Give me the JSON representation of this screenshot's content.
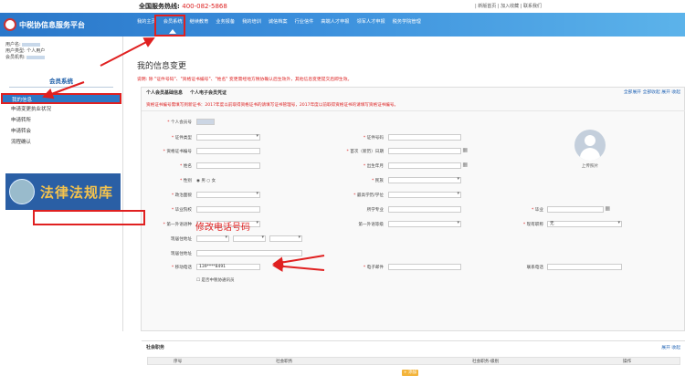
{
  "topbar": {
    "hotline_label": "全国服务热线:",
    "hotline_number": "400-082-5868",
    "links": "| 新版首页 | 加入收藏 | 联系我们"
  },
  "header": {
    "logo_text": "中税协信息服务平台"
  },
  "nav": {
    "items": [
      "我的主页",
      "会员系统",
      "继续教育",
      "业务报备",
      "我的培训",
      "诚信档案",
      "行业信件",
      "高端人才申报",
      "领军人才申报",
      "税务学院管理"
    ]
  },
  "sidebar": {
    "user_label": "用户名:",
    "type_label": "用户类型: 个人用户",
    "company_label": "会员机构:",
    "section_title": "会员系统",
    "menu": [
      "我的信息",
      "申请变更执业状况",
      "申请转所",
      "申请转会",
      "流程确认"
    ],
    "banner_text": "法律法规库"
  },
  "page": {
    "title": "我的信息变更",
    "notice": "说明: 除 \"证件号码\"、\"资格证书编号\"、\"姓名\" 变更需经地方税协确认后生效外，其他信息变更提交后即生效。",
    "tab1": "个人会员基础信息",
    "tab2": "个人电子会员凭证",
    "panel_links": "全部展开 全部收起 展开 收起",
    "red_line": "资格证书编号需填写到新证书：2017年度以前取得资格证书的请填写证书管理号，2017年度以前取得资格证书的请填写资格证书编号。",
    "photo_caption": "上传照片",
    "annotation": "修改电话号码"
  },
  "form": {
    "member_no": "个人会员号",
    "id_type": "证件类型",
    "id_no": "证件号码",
    "cert_no": "资格证书编号",
    "first_date": "首次（新历）日期",
    "name": "姓名",
    "birthday": "出生年月",
    "gender": "性别",
    "gender_male": "男",
    "gender_female": "女",
    "nation": "民族",
    "politics": "政治面貌",
    "education": "最高学历/学位",
    "school": "毕业院校",
    "major": "所学专业",
    "grad_date": "毕业",
    "foreign_lang1": "第一外语语种",
    "foreign_lang1_level": "第一外语等级",
    "title": "现有职称",
    "title_value": "无",
    "address": "现居住地址",
    "address2": "现居住地址",
    "phone": "移动电话",
    "phone_value": "139****8491",
    "email": "电子邮件",
    "tel": "联系电话",
    "checkbox": "是否中税协通讯员"
  },
  "social": {
    "title": "社会职务",
    "link": "展开 收起",
    "columns": [
      "序号",
      "社会职务",
      "社会职务-级别",
      "操作"
    ],
    "add_label": "+ 添加"
  }
}
